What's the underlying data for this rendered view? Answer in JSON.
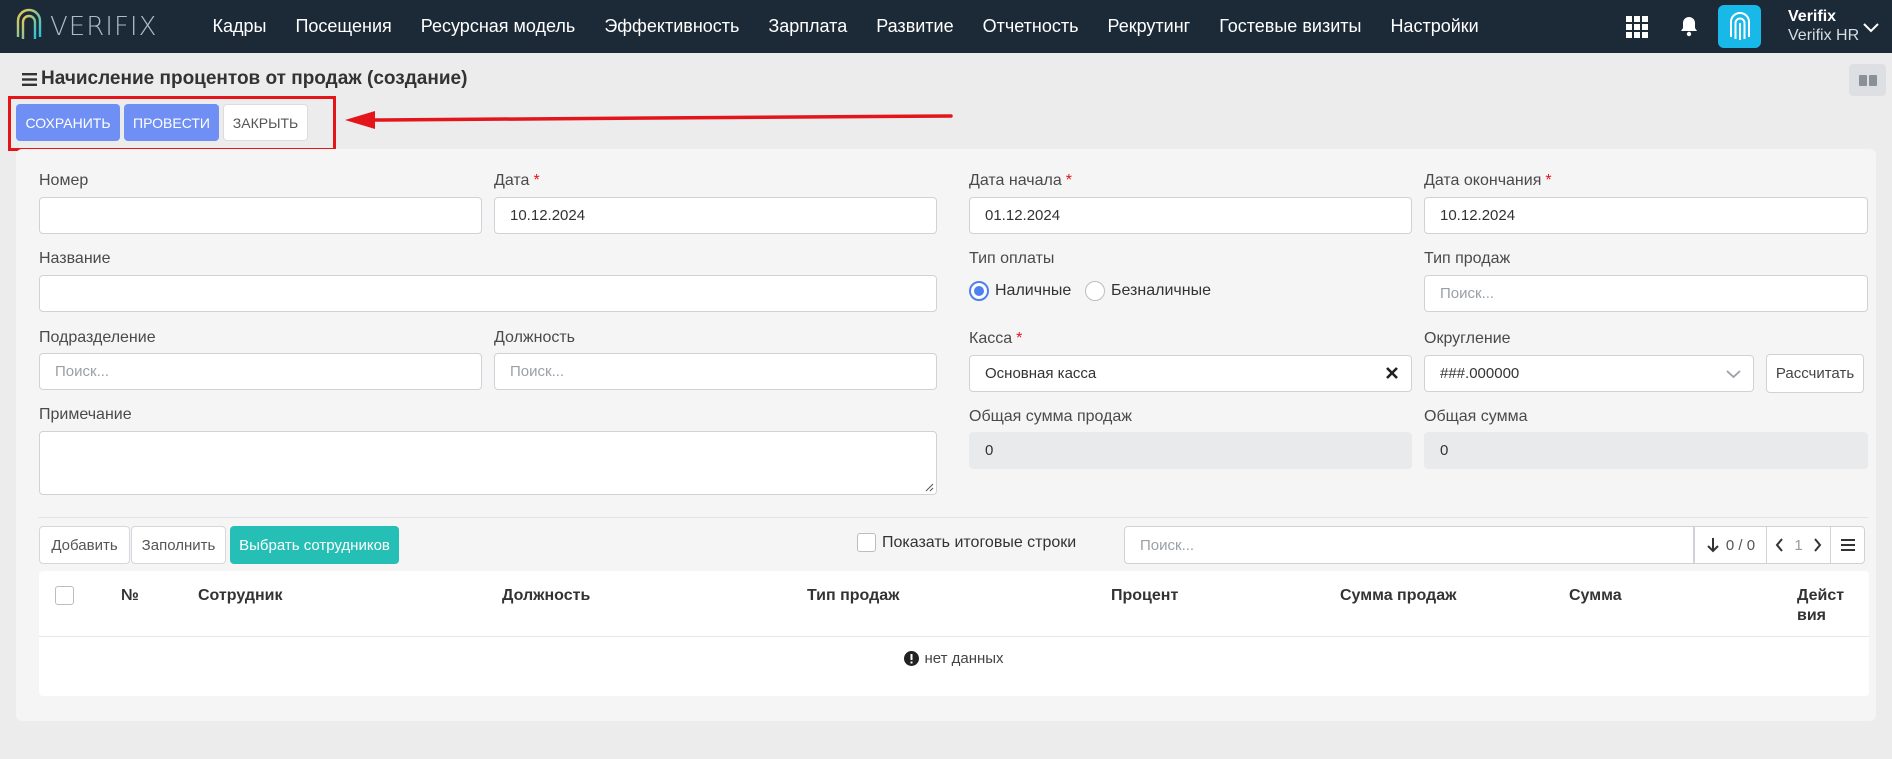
{
  "app": {
    "brand": "VERIFIX"
  },
  "nav": [
    {
      "label": "Кадры"
    },
    {
      "label": "Посещения"
    },
    {
      "label": "Ресурсная модель"
    },
    {
      "label": "Эффективность"
    },
    {
      "label": "Зарплата"
    },
    {
      "label": "Развитие"
    },
    {
      "label": "Отчетность"
    },
    {
      "label": "Рекрутинг"
    },
    {
      "label": "Гостевые визиты"
    },
    {
      "label": "Настройки"
    }
  ],
  "user": {
    "name": "Verifix",
    "company": "Verifix HR"
  },
  "page": {
    "title": "Начисление процентов от продаж (создание)"
  },
  "actions": {
    "save": "СОХРАНИТЬ",
    "post": "ПРОВЕСТИ",
    "close": "ЗАКРЫТЬ"
  },
  "form": {
    "number": {
      "label": "Номер",
      "value": ""
    },
    "date": {
      "label": "Дата",
      "value": "10.12.2024"
    },
    "date_start": {
      "label": "Дата начала",
      "value": "01.12.2024"
    },
    "date_end": {
      "label": "Дата окончания",
      "value": "10.12.2024"
    },
    "name": {
      "label": "Название",
      "value": ""
    },
    "payment_type": {
      "label": "Тип оплаты",
      "options": [
        "Наличные",
        "Безналичные"
      ],
      "selected": "Наличные"
    },
    "sales_type": {
      "label": "Тип продаж",
      "placeholder": "Поиск..."
    },
    "division": {
      "label": "Подразделение",
      "placeholder": "Поиск..."
    },
    "position": {
      "label": "Должность",
      "placeholder": "Поиск..."
    },
    "cashbox": {
      "label": "Касса",
      "value": "Основная касса"
    },
    "rounding": {
      "label": "Округление",
      "value": "###.000000"
    },
    "calculate": "Рассчитать",
    "note": {
      "label": "Примечание",
      "value": ""
    },
    "total_sales": {
      "label": "Общая сумма продаж",
      "value": "0"
    },
    "total": {
      "label": "Общая сумма",
      "value": "0"
    },
    "required_mark": "*"
  },
  "grid": {
    "add": "Добавить",
    "fill": "Заполнить",
    "select_employees": "Выбрать сотрудников",
    "show_totals": "Показать итоговые строки",
    "search_placeholder": "Поиск...",
    "count": "0 / 0",
    "page": "1",
    "columns": [
      "№",
      "Сотрудник",
      "Должность",
      "Тип продаж",
      "Процент",
      "Сумма продаж",
      "Сумма",
      "Дейст вия"
    ],
    "empty": "нет данных"
  },
  "colors": {
    "accent": "#6f8ff4",
    "teal": "#26bfb5",
    "nav_bg": "#1c2a38",
    "annotation": "#e3151b"
  }
}
